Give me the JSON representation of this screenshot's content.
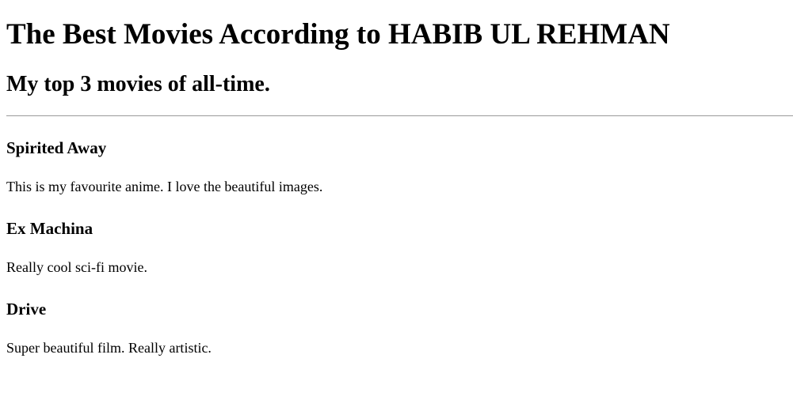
{
  "title": "The Best Movies According to HABIB UL REHMAN",
  "subtitle": "My top 3 movies of all-time.",
  "movies": [
    {
      "name": "Spirited Away",
      "desc": "This is my favourite anime. I love the beautiful images."
    },
    {
      "name": "Ex Machina",
      "desc": "Really cool sci-fi movie."
    },
    {
      "name": "Drive",
      "desc": "Super beautiful film. Really artistic."
    }
  ]
}
